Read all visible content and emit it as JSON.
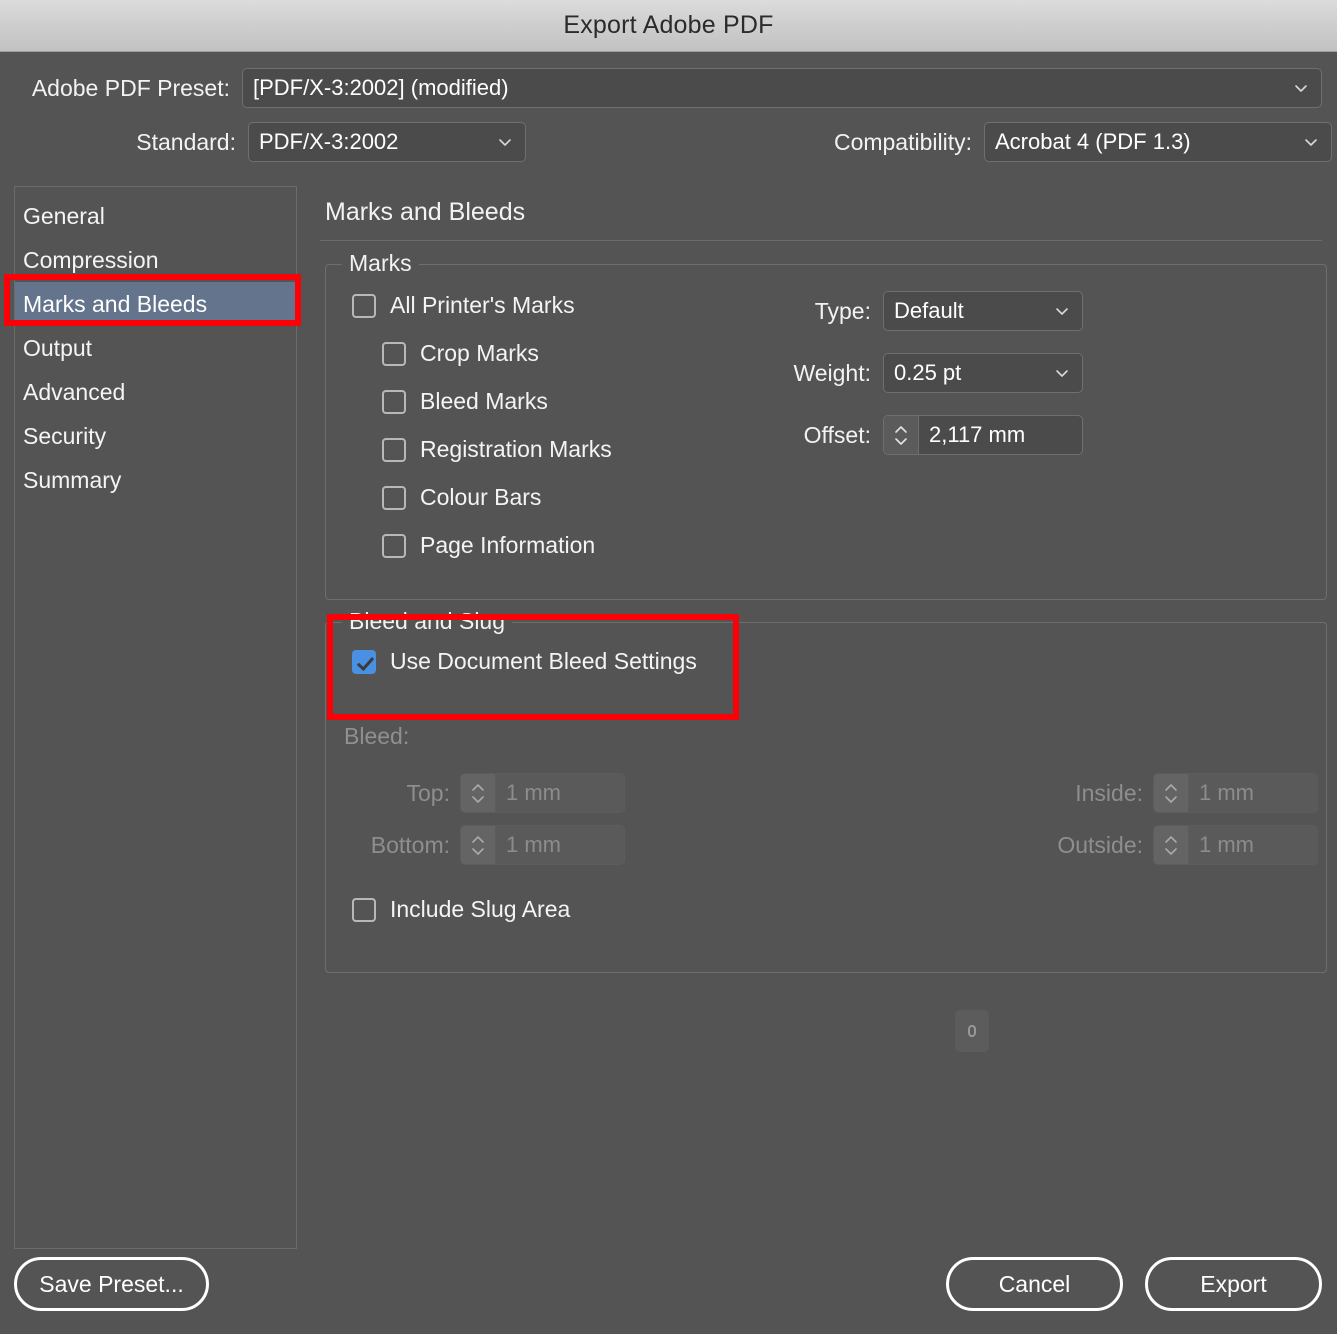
{
  "window": {
    "title": "Export Adobe PDF"
  },
  "header": {
    "preset_label": "Adobe PDF Preset:",
    "preset_value": "[PDF/X-3:2002] (modified)",
    "standard_label": "Standard:",
    "standard_value": "PDF/X-3:2002",
    "compatibility_label": "Compatibility:",
    "compatibility_value": "Acrobat 4 (PDF 1.3)"
  },
  "sidebar": {
    "items": [
      {
        "label": "General",
        "selected": false
      },
      {
        "label": "Compression",
        "selected": false
      },
      {
        "label": "Marks and Bleeds",
        "selected": true
      },
      {
        "label": "Output",
        "selected": false
      },
      {
        "label": "Advanced",
        "selected": false
      },
      {
        "label": "Security",
        "selected": false
      },
      {
        "label": "Summary",
        "selected": false
      }
    ]
  },
  "panel": {
    "title": "Marks and Bleeds",
    "marks_group": {
      "legend": "Marks",
      "checkboxes": [
        {
          "label": "All Printer's Marks",
          "checked": false
        },
        {
          "label": "Crop Marks",
          "checked": false
        },
        {
          "label": "Bleed Marks",
          "checked": false
        },
        {
          "label": "Registration Marks",
          "checked": false
        },
        {
          "label": "Colour Bars",
          "checked": false
        },
        {
          "label": "Page Information",
          "checked": false
        }
      ],
      "type_label": "Type:",
      "type_value": "Default",
      "weight_label": "Weight:",
      "weight_value": "0.25 pt",
      "offset_label": "Offset:",
      "offset_value": "2,117 mm"
    },
    "bleed_group": {
      "legend": "Bleed and Slug",
      "use_doc_bleed_label": "Use Document Bleed Settings",
      "use_doc_bleed_checked": true,
      "bleed_caption": "Bleed:",
      "top_label": "Top:",
      "top_value": "1 mm",
      "bottom_label": "Bottom:",
      "bottom_value": "1 mm",
      "inside_label": "Inside:",
      "inside_value": "1 mm",
      "outside_label": "Outside:",
      "outside_value": "1 mm",
      "link_icon": "chain-link-icon",
      "include_slug_label": "Include Slug Area",
      "include_slug_checked": false
    }
  },
  "footer": {
    "save_preset_label": "Save Preset...",
    "cancel_label": "Cancel",
    "export_label": "Export"
  },
  "annotations": {
    "highlight_color": "#fb0007",
    "boxes": [
      "marks-and-bleeds-nav-highlight",
      "bleed-and-slug-highlight"
    ]
  },
  "colors": {
    "window_background": "#545454",
    "titlebar_background": "#cfcfcf",
    "selected_nav": "#63748c",
    "checkbox_checked": "#4a90e2",
    "annotation_red": "#fb0007"
  }
}
